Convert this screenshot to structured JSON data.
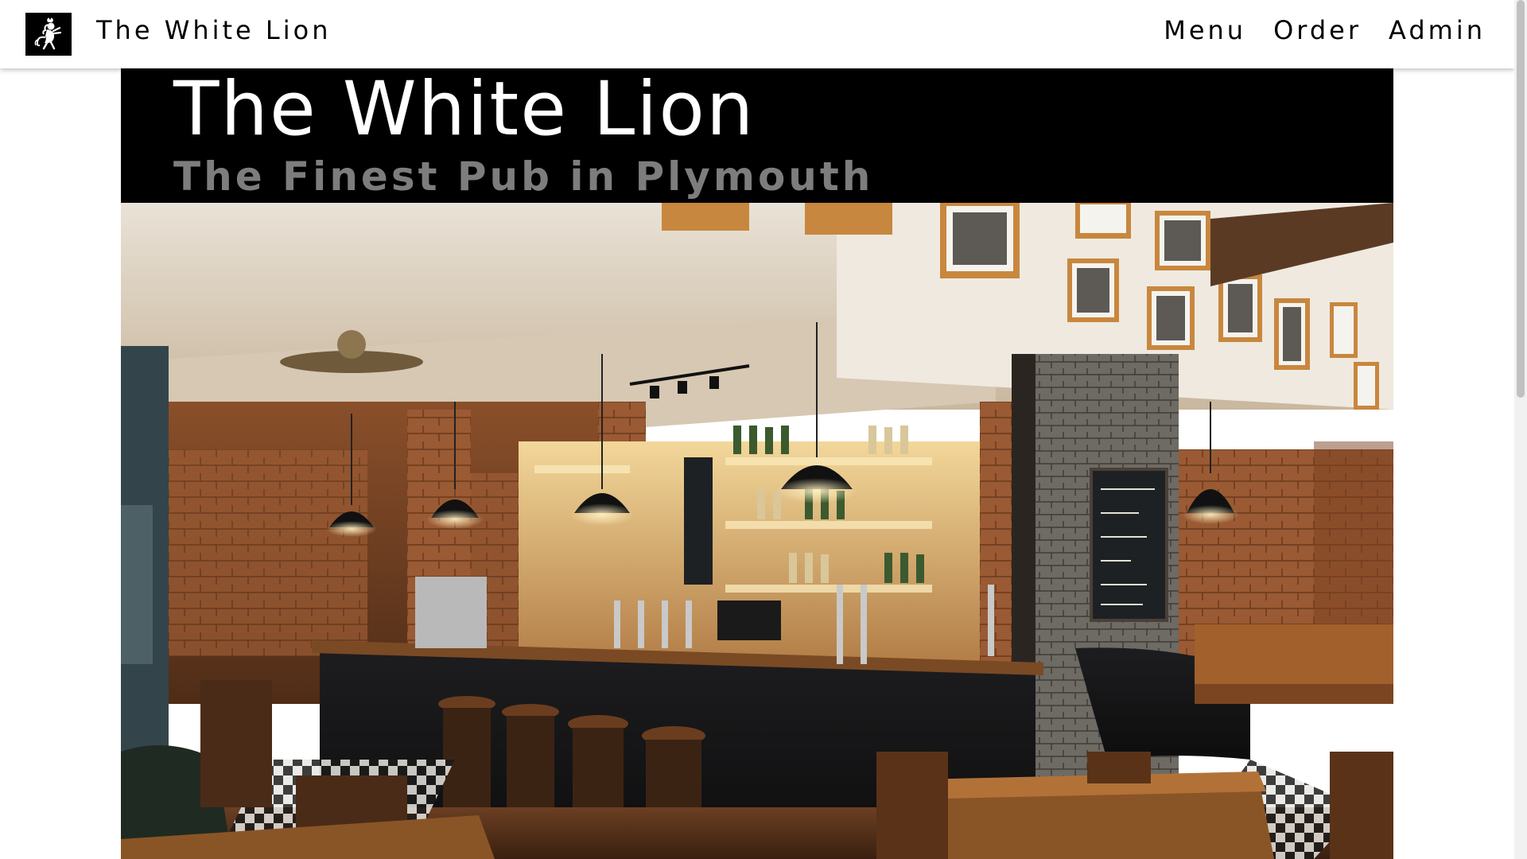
{
  "nav": {
    "brand": "The White Lion",
    "logo_icon": "lion-icon",
    "links": [
      {
        "label": "Menu"
      },
      {
        "label": "Order"
      },
      {
        "label": "Admin"
      }
    ]
  },
  "hero": {
    "title": "The White Lion",
    "subtitle": "The Finest Pub in Plymouth",
    "image_icon": "pub-interior-photo"
  },
  "colors": {
    "header_bg": "#000000",
    "subtitle": "#7d7d7d",
    "nav_bg": "#ffffff"
  }
}
